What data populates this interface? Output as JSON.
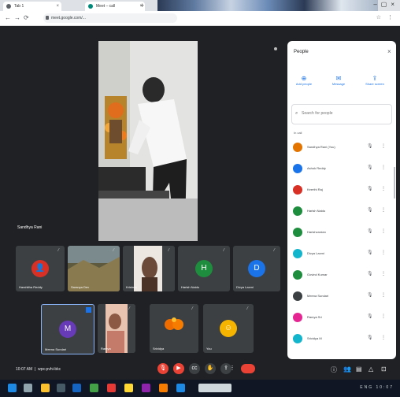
{
  "browser": {
    "tabs": [
      {
        "label": "Tab 1",
        "color": "#5f6368"
      },
      {
        "label": "Meet – call",
        "color": "#00897b"
      },
      {
        "label": "",
        "color": "#1a73e8"
      }
    ],
    "address": "meet.google.com/..."
  },
  "meeting": {
    "spotlight_name": "Sandhya Rani",
    "time": "10:07 AM",
    "meeting_code": "wpx-pvhi-bkc",
    "tiles_row1": [
      {
        "name": "Harshitha Reddy",
        "avatar_color": "#d93025",
        "type": "avatar"
      },
      {
        "name": "Saranya Dev",
        "type": "scene"
      },
      {
        "name": "Krishna",
        "type": "scene"
      },
      {
        "name": "Harish Naidu",
        "avatar_color": "#1e8e3e",
        "type": "avatar"
      },
      {
        "name": "Divya Laxmi",
        "avatar_color": "#1a73e8",
        "type": "avatar"
      }
    ],
    "tiles_row2": [
      {
        "name": "Meena Sundari",
        "avatar_color": "#673ab7",
        "letter": "M",
        "type": "avatar"
      },
      {
        "name": "Ramya",
        "type": "scene"
      },
      {
        "name": "Srividya",
        "type": "flowers"
      },
      {
        "name": "You",
        "avatar_color": "#f4b400",
        "type": "avatar"
      }
    ]
  },
  "panel": {
    "title": "People",
    "actions": [
      {
        "label": "Add people",
        "icon": "person-add-icon",
        "glyph": "⊕"
      },
      {
        "label": "Message",
        "icon": "chat-icon",
        "glyph": "✉"
      },
      {
        "label": "Share screen",
        "icon": "present-icon",
        "glyph": "⇪"
      }
    ],
    "search_placeholder": "Search for people",
    "in_call_label": "In call",
    "participants": [
      {
        "name": "Sandhya Rani (You)",
        "color": "#e37400"
      },
      {
        "name": "Ashok Reddy",
        "color": "#1a73e8"
      },
      {
        "name": "Keerthi Raj",
        "color": "#d93025"
      },
      {
        "name": "Harish Naidu",
        "color": "#1e8e3e"
      },
      {
        "name": "Harishvardan",
        "color": "#1e8e3e"
      },
      {
        "name": "Divya Laxmi",
        "color": "#12b5cb"
      },
      {
        "name": "Govind Kumar",
        "color": "#1e8e3e"
      },
      {
        "name": "Meena Sundari",
        "color": "#3c4043"
      },
      {
        "name": "Ramya Sri",
        "color": "#e52592"
      },
      {
        "name": "Srividya M",
        "color": "#12b5cb"
      }
    ]
  },
  "taskbar": {
    "tray": "ENG  10:07"
  }
}
